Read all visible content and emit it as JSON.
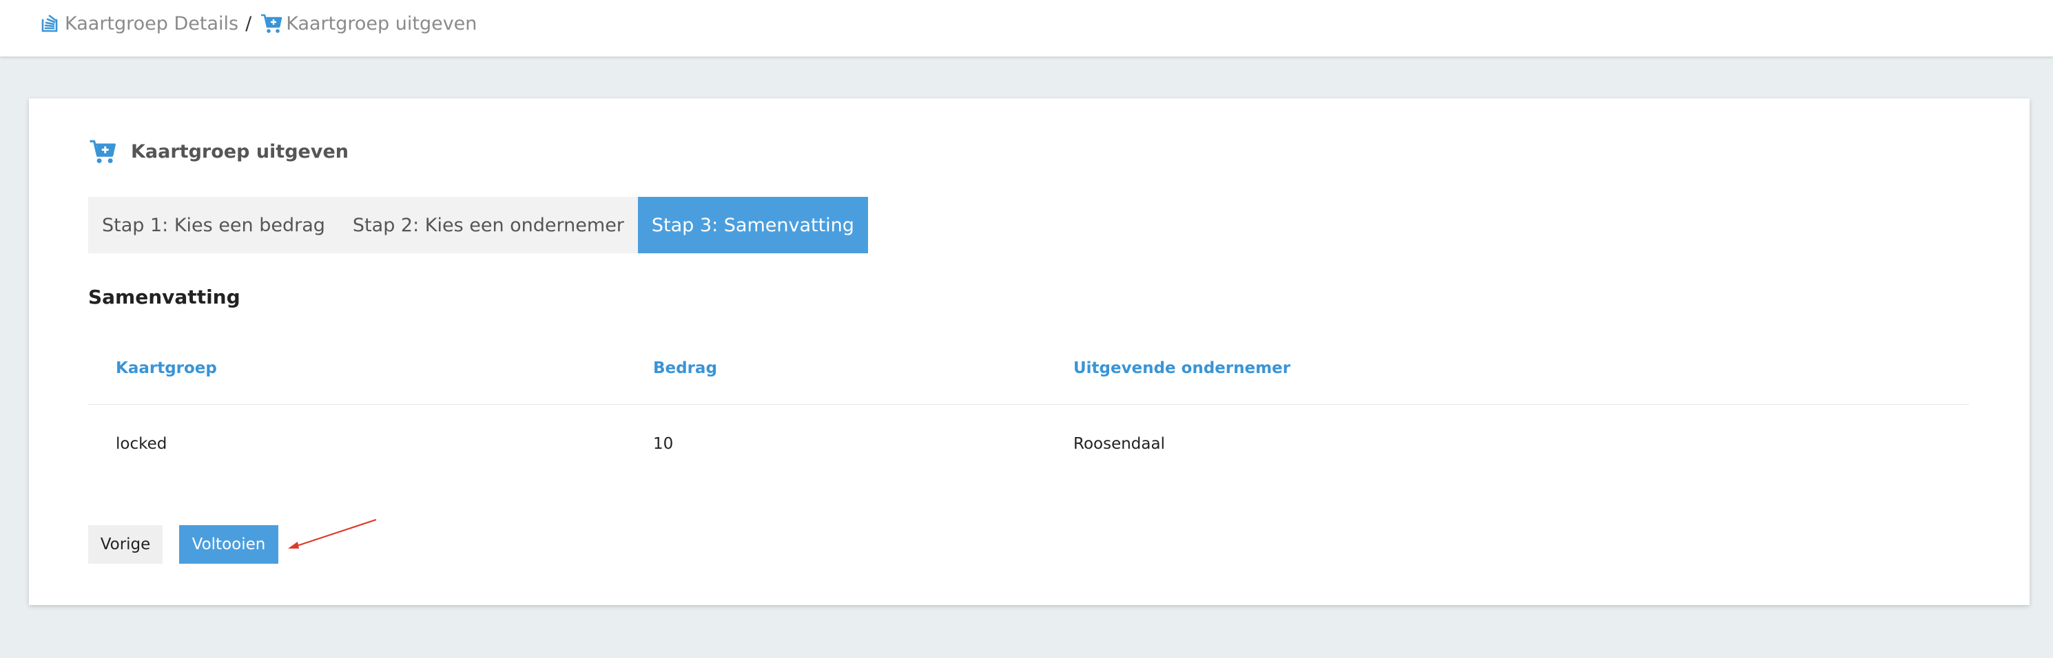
{
  "breadcrumb": {
    "items": [
      {
        "label": "Kaartgroep Details",
        "icon": "stack-icon"
      },
      {
        "label": "Kaartgroep uitgeven",
        "icon": "cart-plus-icon"
      }
    ],
    "separator": "/"
  },
  "card": {
    "title": "Kaartgroep uitgeven",
    "title_icon": "cart-plus-icon"
  },
  "steps": [
    {
      "label": "Stap 1: Kies een bedrag",
      "active": false
    },
    {
      "label": "Stap 2: Kies een ondernemer",
      "active": false
    },
    {
      "label": "Stap 3: Samenvatting",
      "active": true
    }
  ],
  "summary": {
    "heading": "Samenvatting",
    "columns": [
      "Kaartgroep",
      "Bedrag",
      "Uitgevende ondernemer"
    ],
    "rows": [
      [
        "locked",
        "10",
        "Roosendaal"
      ]
    ]
  },
  "actions": {
    "prev_label": "Vorige",
    "finish_label": "Voltooien"
  },
  "colors": {
    "accent": "#4a9ede",
    "header_text": "#3a94d6",
    "annotation": "#e0382b"
  }
}
